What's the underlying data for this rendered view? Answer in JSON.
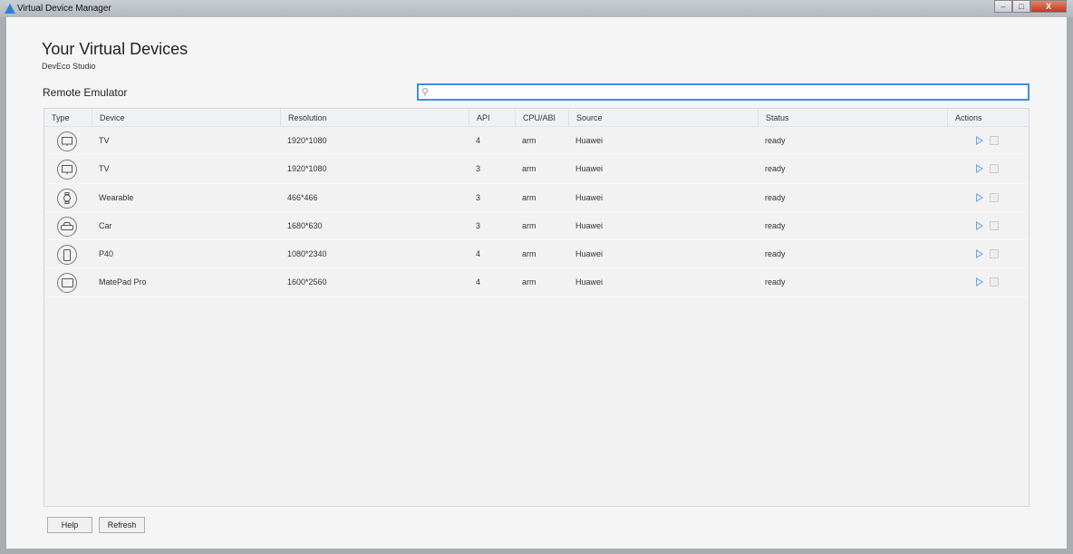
{
  "window": {
    "title": "Virtual Device Manager",
    "minimize": "–",
    "maximize": "□",
    "close": "X"
  },
  "header": {
    "title": "Your Virtual Devices",
    "subtitle": "DevEco Studio"
  },
  "section": {
    "title": "Remote Emulator"
  },
  "search": {
    "placeholder": "",
    "value": "",
    "icon": "search-icon"
  },
  "table": {
    "columns": [
      "Type",
      "Device",
      "Resolution",
      "API",
      "CPU/ABI",
      "Source",
      "Status",
      "Actions"
    ],
    "rows": [
      {
        "type": "tv",
        "device": "TV",
        "resolution": "1920*1080",
        "api": "4",
        "cpu": "arm",
        "source": "Huawei",
        "status": "ready"
      },
      {
        "type": "tv",
        "device": "TV",
        "resolution": "1920*1080",
        "api": "3",
        "cpu": "arm",
        "source": "Huawei",
        "status": "ready"
      },
      {
        "type": "watch",
        "device": "Wearable",
        "resolution": "466*466",
        "api": "3",
        "cpu": "arm",
        "source": "Huawei",
        "status": "ready"
      },
      {
        "type": "car",
        "device": "Car",
        "resolution": "1680*630",
        "api": "3",
        "cpu": "arm",
        "source": "Huawei",
        "status": "ready"
      },
      {
        "type": "phone",
        "device": "P40",
        "resolution": "1080*2340",
        "api": "4",
        "cpu": "arm",
        "source": "Huawei",
        "status": "ready"
      },
      {
        "type": "tablet",
        "device": "MatePad Pro",
        "resolution": "1600*2560",
        "api": "4",
        "cpu": "arm",
        "source": "Huawei",
        "status": "ready"
      }
    ]
  },
  "footer": {
    "help": "Help",
    "refresh": "Refresh"
  },
  "colors": {
    "accent": "#3d8ee8",
    "play": "#6aa8ee"
  }
}
